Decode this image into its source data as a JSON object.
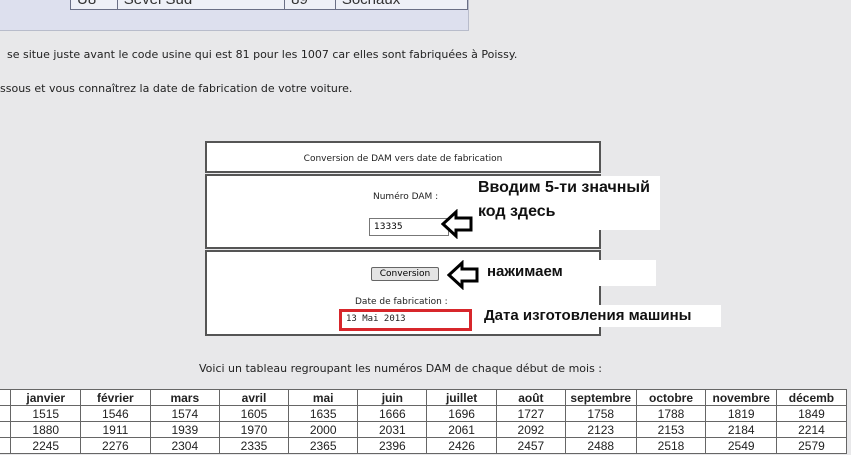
{
  "top_table": {
    "cells": [
      "U8",
      "Sevel Sud",
      "89",
      "Sochaux"
    ]
  },
  "paragraph_1": "se situe juste avant le code usine qui est 81 pour les 1007 car elles sont fabriquées à Poissy.",
  "paragraph_2": "ssous et vous connaîtrez la date de fabrication de votre voiture.",
  "converter": {
    "title": "Conversion de DAM vers date de fabrication",
    "dam_label": "Numéro DAM :",
    "dam_value": "13335",
    "button_label": "Conversion",
    "date_label": "Date de fabrication :",
    "date_value": "13 Mai 2013"
  },
  "annotations": {
    "enter_code": "Вводим 5-ти значный код здесь",
    "press": "нажимаем",
    "date": "Дата изготовления машины"
  },
  "table_caption": "Voici un tableau regroupant les numéros DAM de chaque début de mois :",
  "months_table": {
    "headers": [
      "janvier",
      "février",
      "mars",
      "avril",
      "mai",
      "juin",
      "juillet",
      "août",
      "septembre",
      "octobre",
      "novembre",
      "décemb"
    ],
    "rows": [
      [
        "1515",
        "1546",
        "1574",
        "1605",
        "1635",
        "1666",
        "1696",
        "1727",
        "1758",
        "1788",
        "1819",
        "1849"
      ],
      [
        "1880",
        "1911",
        "1939",
        "1970",
        "2000",
        "2031",
        "2061",
        "2092",
        "2123",
        "2153",
        "2184",
        "2214"
      ],
      [
        "2245",
        "2276",
        "2304",
        "2335",
        "2365",
        "2396",
        "2426",
        "2457",
        "2488",
        "2518",
        "2549",
        "2579"
      ]
    ]
  },
  "colors": {
    "highlight_border": "#d7262b",
    "arrow": "#000000",
    "page_bg": "#e8e8ea"
  }
}
